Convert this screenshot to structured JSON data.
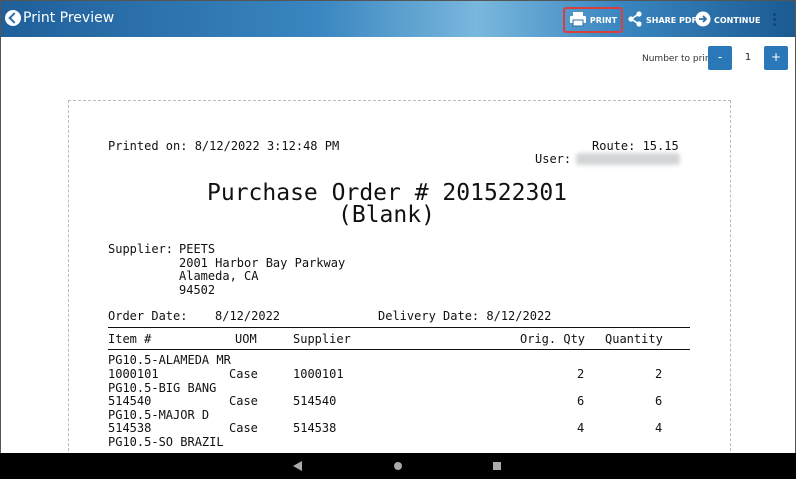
{
  "header": {
    "title": "Print Preview",
    "actions": {
      "print": "PRINT",
      "share_pdf": "SHARE PDF",
      "continue": "CONTINUE"
    }
  },
  "controls": {
    "number_to_print_label": "Number to print",
    "minus": "-",
    "plus": "+",
    "value": "1"
  },
  "document": {
    "printed_on": "Printed on: 8/12/2022 3:12:48 PM",
    "route": "Route: 15.15",
    "user_label": "User:",
    "title_line1": "Purchase Order # 201522301",
    "title_line2": "(Blank)",
    "supplier_label": "Supplier:",
    "supplier_name": "PEETS",
    "supplier_address1": "2001 Harbor Bay Parkway",
    "supplier_address2": "Alameda, CA",
    "supplier_zip": "94502",
    "order_date_label": "Order Date:",
    "order_date": "8/12/2022",
    "delivery_date": "Delivery Date: 8/12/2022",
    "columns": {
      "item": "Item #",
      "uom": "UOM",
      "supplier": "Supplier",
      "orig_qty": "Orig. Qty",
      "quantity": "Quantity"
    },
    "items": [
      {
        "name": "PG10.5-ALAMEDA MR",
        "item": "1000101",
        "uom": "Case",
        "supplier": "1000101",
        "orig_qty": "2",
        "quantity": "2"
      },
      {
        "name": "PG10.5-BIG BANG",
        "item": "514540",
        "uom": "Case",
        "supplier": "514540",
        "orig_qty": "6",
        "quantity": "6"
      },
      {
        "name": "PG10.5-MAJOR D",
        "item": "514538",
        "uom": "Case",
        "supplier": "514538",
        "orig_qty": "4",
        "quantity": "4"
      },
      {
        "name": "PG10.5-SO BRAZIL",
        "item": "",
        "uom": "",
        "supplier": "",
        "orig_qty": "",
        "quantity": ""
      }
    ]
  },
  "colors": {
    "header_blue": "#2a6fad",
    "highlight_red": "#d9403b",
    "stepper_blue": "#2b78b8"
  }
}
